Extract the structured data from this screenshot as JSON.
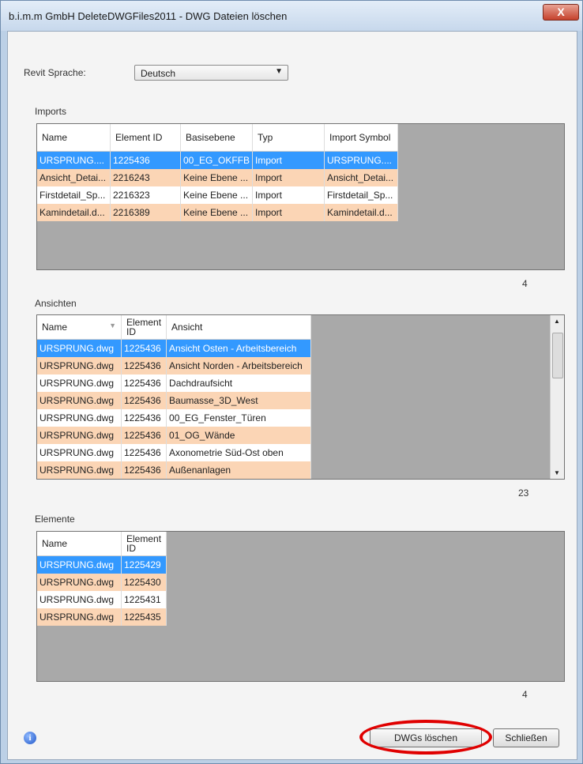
{
  "window": {
    "title": "b.i.m.m GmbH DeleteDWGFiles2011 - DWG Dateien löschen",
    "close_label": "X"
  },
  "language": {
    "label": "Revit Sprache:",
    "value": "Deutsch"
  },
  "imports": {
    "section_label": "Imports",
    "columns": [
      "Name",
      "Element ID",
      "Basisebene",
      "Typ",
      "Import Symbol"
    ],
    "rows": [
      [
        "URSPRUNG....",
        "1225436",
        "00_EG_OKFFB",
        "Import",
        "URSPRUNG...."
      ],
      [
        "Ansicht_Detai...",
        "2216243",
        "Keine Ebene ...",
        "Import",
        "Ansicht_Detai..."
      ],
      [
        "Firstdetail_Sp...",
        "2216323",
        "Keine Ebene ...",
        "Import",
        "Firstdetail_Sp..."
      ],
      [
        "Kamindetail.d...",
        "2216389",
        "Keine Ebene ...",
        "Import",
        "Kamindetail.d..."
      ]
    ],
    "count": "4"
  },
  "ansichten": {
    "section_label": "Ansichten",
    "columns": [
      "Name",
      "Element ID",
      "Ansicht"
    ],
    "rows": [
      [
        "URSPRUNG.dwg",
        "1225436",
        "Ansicht Osten - Arbeitsbereich"
      ],
      [
        "URSPRUNG.dwg",
        "1225436",
        "Ansicht Norden - Arbeitsbereich"
      ],
      [
        "URSPRUNG.dwg",
        "1225436",
        "Dachdraufsicht"
      ],
      [
        "URSPRUNG.dwg",
        "1225436",
        "Baumasse_3D_West"
      ],
      [
        "URSPRUNG.dwg",
        "1225436",
        "00_EG_Fenster_Türen"
      ],
      [
        "URSPRUNG.dwg",
        "1225436",
        "01_OG_Wände"
      ],
      [
        "URSPRUNG.dwg",
        "1225436",
        "Axonometrie Süd-Ost oben"
      ],
      [
        "URSPRUNG.dwg",
        "1225436",
        "Außenanlagen"
      ]
    ],
    "count": "23"
  },
  "elemente": {
    "section_label": "Elemente",
    "columns": [
      "Name",
      "Element ID"
    ],
    "rows": [
      [
        "URSPRUNG.dwg",
        "1225429"
      ],
      [
        "URSPRUNG.dwg",
        "1225430"
      ],
      [
        "URSPRUNG.dwg",
        "1225431"
      ],
      [
        "URSPRUNG.dwg",
        "1225435"
      ]
    ],
    "count": "4"
  },
  "buttons": {
    "delete": "DWGs löschen",
    "close": "Schließen"
  },
  "colors": {
    "selected": "#3399ff",
    "alternate": "#fbd5b5",
    "highlight_circle": "#e00000"
  },
  "icons": {
    "info": "info-icon"
  }
}
